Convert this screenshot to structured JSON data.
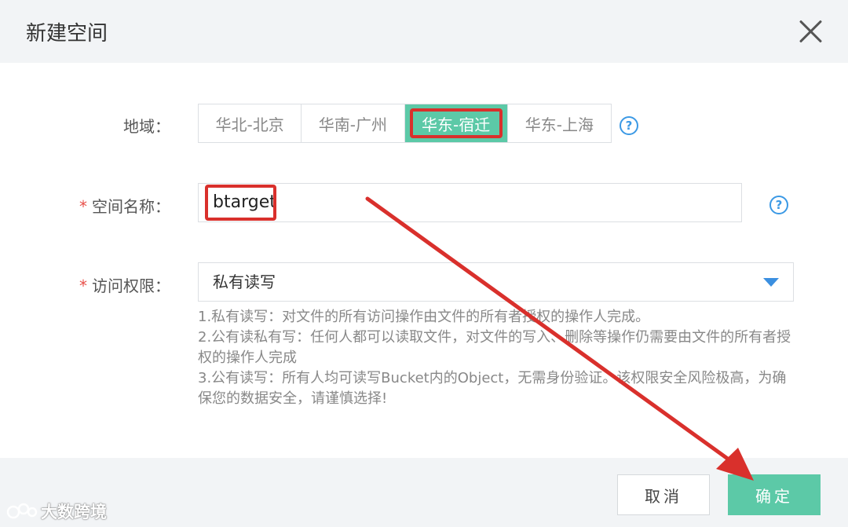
{
  "dialog": {
    "title": "新建空间"
  },
  "region": {
    "label": "地域：",
    "options": [
      "华北-北京",
      "华南-广州",
      "华东-宿迁",
      "华东-上海"
    ],
    "selected": "华东-宿迁"
  },
  "space_name": {
    "label": "空间名称：",
    "required_mark": "*",
    "value": "btarget"
  },
  "access": {
    "label": "访问权限：",
    "required_mark": "*",
    "selected": "私有读写",
    "descriptions": [
      "1.私有读写：对文件的所有访问操作由文件的所有者授权的操作人完成。",
      "2.公有读私有写：任何人都可以读取文件，对文件的写入、删除等操作仍需要由文件的所有者授权的操作人完成",
      "3.公有读写：所有人均可读写Bucket内的Object，无需身份验证。该权限安全风险极高，为确保您的数据安全，请谨慎选择!"
    ]
  },
  "help_icon": "?",
  "buttons": {
    "cancel": "取消",
    "ok": "确定"
  },
  "watermark": {
    "text": "大数跨境"
  },
  "icons": [
    "close-icon",
    "help-icon",
    "dropdown-arrow-icon",
    "annotation-arrow"
  ],
  "colors": {
    "accent": "#5cc9a7",
    "annotation": "#d9302c",
    "help": "#3b99e5"
  }
}
